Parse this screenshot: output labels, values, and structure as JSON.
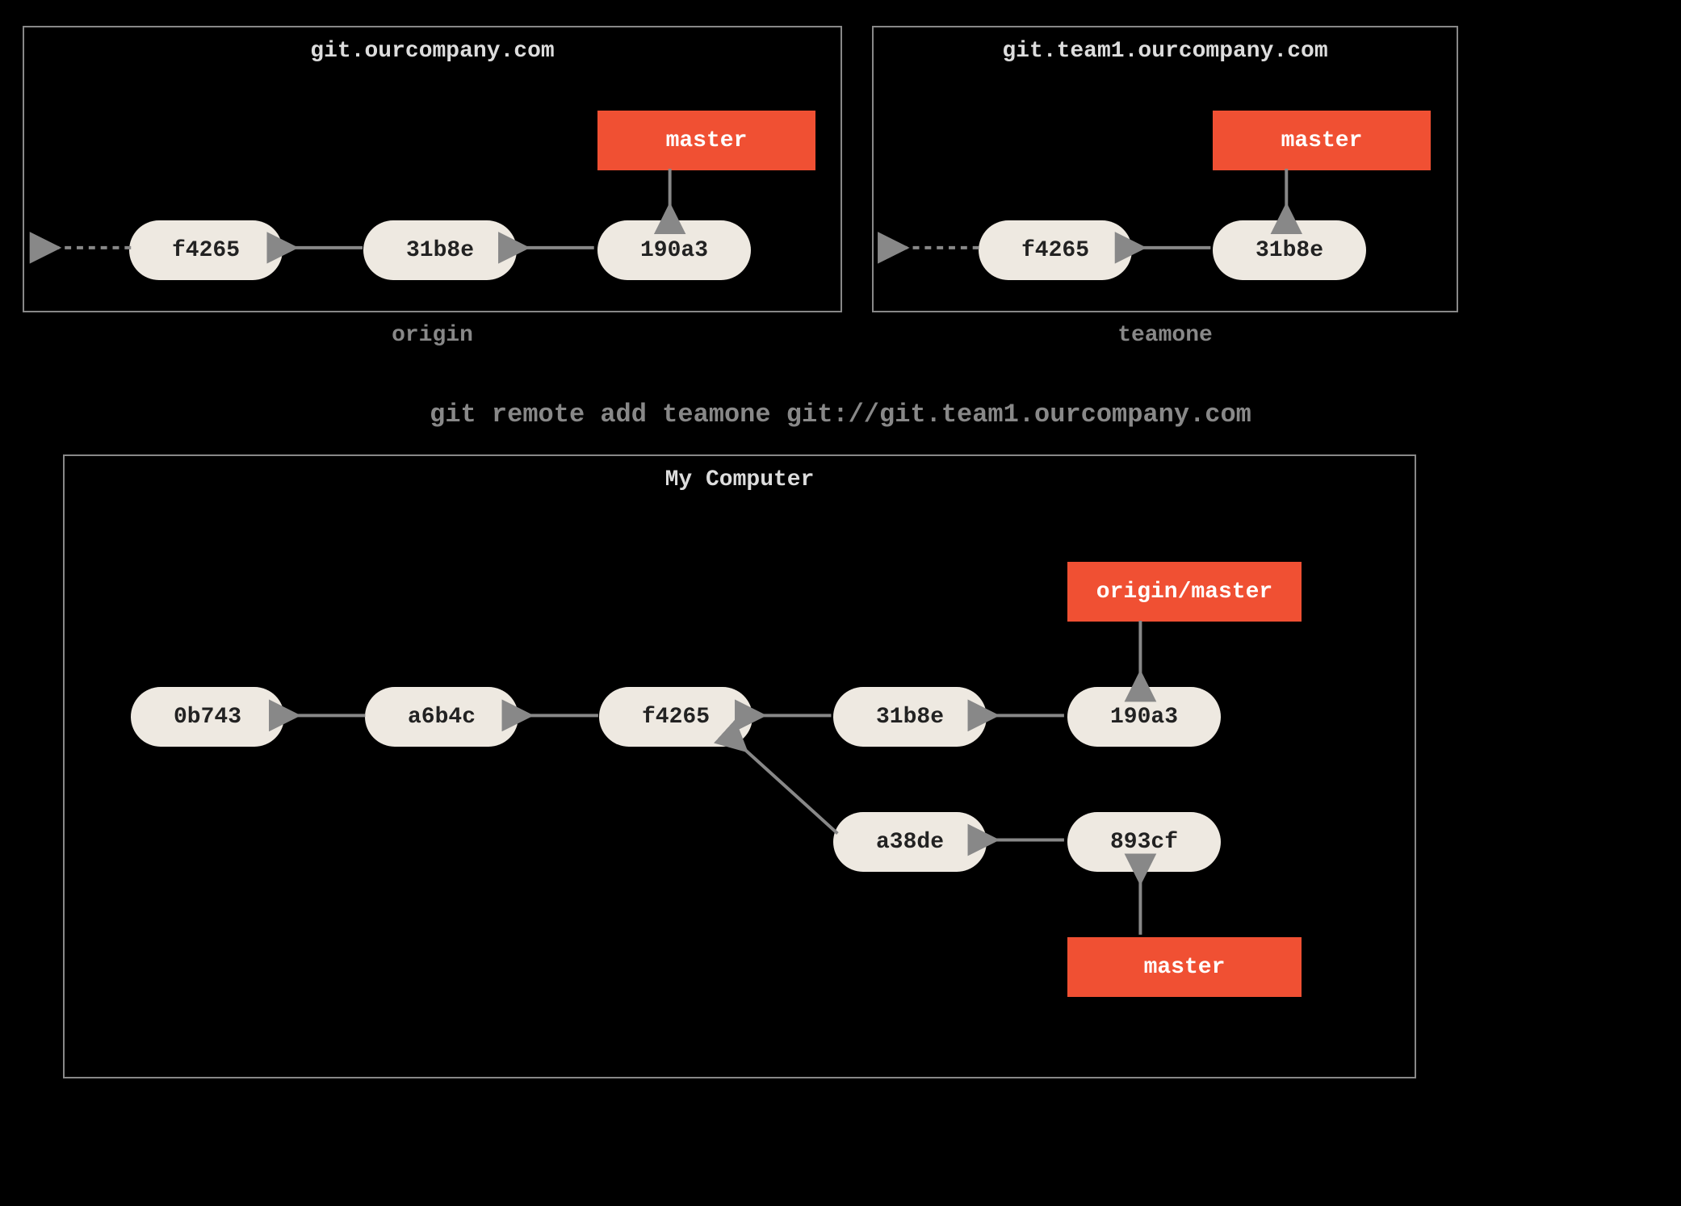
{
  "origin_panel": {
    "title": "git.ourcompany.com",
    "remote_label": "origin",
    "branch": "master",
    "commits": [
      "f4265",
      "31b8e",
      "190a3"
    ]
  },
  "teamone_panel": {
    "title": "git.team1.ourcompany.com",
    "remote_label": "teamone",
    "branch": "master",
    "commits": [
      "f4265",
      "31b8e"
    ]
  },
  "command": "git remote add teamone git://git.team1.ourcompany.com",
  "local_panel": {
    "title": "My Computer",
    "remote_branch": "origin/master",
    "local_branch": "master",
    "main_commits": [
      "0b743",
      "a6b4c",
      "f4265",
      "31b8e",
      "190a3"
    ],
    "branch_commits": [
      "a38de",
      "893cf"
    ]
  },
  "colors": {
    "bg": "#000000",
    "commit_bg": "#eee9e1",
    "branch_bg": "#f05033",
    "border": "#888888",
    "text_muted": "#888888",
    "text_title": "#dddddd"
  }
}
